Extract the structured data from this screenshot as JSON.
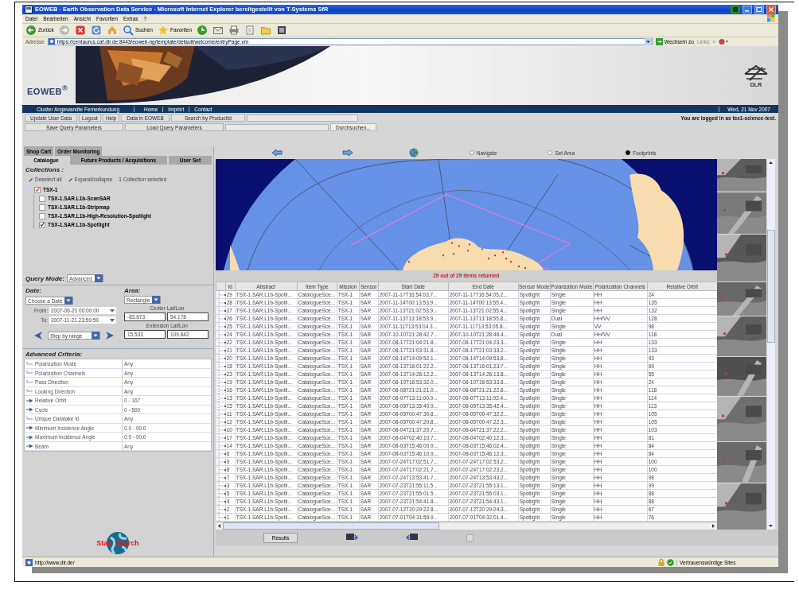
{
  "browser": {
    "title": "EOWEB - Earth Observation Data Service - Microsoft Internet Explorer bereitgestellt von T-Systems SfR",
    "menu": [
      "Datei",
      "Bearbeiten",
      "Ansicht",
      "Favoriten",
      "Extras",
      "?"
    ],
    "toolbar": [
      {
        "kind": "back",
        "label": "Zurück"
      },
      {
        "kind": "forward"
      },
      {
        "kind": "stop"
      },
      {
        "kind": "refresh"
      },
      {
        "kind": "home"
      },
      {
        "kind": "search",
        "label": "Suchen"
      },
      {
        "kind": "favorites",
        "label": "Favoriten"
      },
      {
        "kind": "history"
      },
      {
        "kind": "mail"
      },
      {
        "kind": "print"
      },
      {
        "kind": "edit"
      },
      {
        "kind": "folder"
      },
      {
        "kind": "media"
      }
    ],
    "address": {
      "label": "Adresse",
      "url": "https://centaurus.caf.dlr.de:8443/eoweb-ng/template/default/welcome/entryPage.vm",
      "go": "Wechseln zu",
      "links": "Links",
      "more": "»"
    },
    "status": {
      "url": "http://www.dlr.de/",
      "zone": "Vertrauenswürdige Sites"
    }
  },
  "header": {
    "logo": "EOWEB$^{®}$",
    "emblem": "DLR"
  },
  "nav": {
    "items": [
      "Cluster Angewandte Fernerkundung",
      "Home",
      "Imprint",
      "Contact"
    ],
    "date": "Wed, 21 Nov 2007"
  },
  "actions": {
    "row1": [
      "Update User Data",
      "Logout",
      "Help",
      "Data in EOWEB",
      "Search by ProductId"
    ],
    "login": "You are logged in as tsx1-science-test.",
    "row2": [
      "Save Query Parameters",
      "Load Query Parameters"
    ],
    "browse": "Durchsuchen..."
  },
  "left": {
    "tabs_top": [
      {
        "label": "Shop Cart",
        "selected": false
      },
      {
        "label": "Order Monitoring",
        "selected": false
      }
    ],
    "tabs": [
      {
        "label": "Catalogue",
        "selected": true
      },
      {
        "label": "Future Products / Acquisitions",
        "selected": false
      },
      {
        "label": "User Set",
        "selected": false
      }
    ],
    "collections": {
      "title": "Collections :",
      "tools": [
        "Deselect all",
        "Expand/collapse"
      ],
      "count": "1 Collection selected",
      "tree": [
        {
          "label": "TSX-1",
          "checked": true,
          "children": [
            {
              "label": "TSX-1.SAR.L1b-ScanSAR",
              "checked": false
            },
            {
              "label": "TSX-1.SAR.L1b-Stripmap",
              "checked": false
            },
            {
              "label": "TSX-1.SAR.L1b-High-Resolution-Spotlight",
              "checked": false
            },
            {
              "label": "TSX-1.SAR.L1b-Spotlight",
              "checked": true
            }
          ]
        }
      ]
    },
    "query_mode": {
      "label": "Query Mode:",
      "value": "Advanced"
    },
    "date": {
      "title": "Date:",
      "mode": "Choose a Date",
      "from_label": "From:",
      "from": "2007-06-21 00:00:00",
      "to_label": "To:",
      "to": "2007-11-21 23:59:59",
      "step": "Step by range"
    },
    "area": {
      "title": "Area:",
      "shape": "Rectangle",
      "center_label": "Center Lat/Lon",
      "center": [
        "-83.673",
        "54.178"
      ],
      "extension_label": "Extension Lat/Lon",
      "extension": [
        "15.533",
        "109.842"
      ]
    },
    "criteria": {
      "title": "Advanced Criteria:",
      "rows": [
        {
          "label": "Polarization Mode",
          "value": "Any",
          "expandable": false
        },
        {
          "label": "Polarization Channels",
          "value": "Any",
          "expandable": false
        },
        {
          "label": "Pass Direction",
          "value": "Any",
          "expandable": false
        },
        {
          "label": "Looking Direction",
          "value": "Any",
          "expandable": false
        },
        {
          "label": "Relative Orbit",
          "value": "0 - 167",
          "expandable": true
        },
        {
          "label": "Cycle",
          "value": "0 - 500",
          "expandable": true
        },
        {
          "label": "Unique Datatake Id",
          "value": "Any",
          "expandable": false
        },
        {
          "label": "Minimum Incidence Angle",
          "value": "0.0 - 90.0",
          "expandable": true
        },
        {
          "label": "Maximum Incidence Angle",
          "value": "0.0 - 90.0",
          "expandable": true
        },
        {
          "label": "Beam",
          "value": "Any",
          "expandable": true
        }
      ]
    },
    "search": "Start Search"
  },
  "map": {
    "modes": [
      {
        "label": "Navigate",
        "selected": false
      },
      {
        "label": "Set Area",
        "selected": false
      },
      {
        "label": "Footprints",
        "selected": true
      }
    ]
  },
  "results": {
    "summary": "29 out of 29 items returned",
    "columns": [
      "Id",
      "Abstract",
      "Item Type",
      "Mission",
      "Sensor",
      "Start Date",
      "End Date",
      "Sensor Mode",
      "Polarization Mode",
      "Polarization Channels",
      "Relative Orbit"
    ],
    "rows": [
      [
        "29",
        "TSX-1.SAR.L1b-Spotli...",
        "CatalogueSce...",
        "TSX-1",
        "SAR",
        "2007-11-17T16:54:03.7...",
        "2007-11-17T16:54:05.2...",
        "Spotlight",
        "Single",
        "HH",
        "24"
      ],
      [
        "28",
        "TSX-1.SAR.L1b-Spotli...",
        "CatalogueSce...",
        "TSX-1",
        "SAR",
        "2007-11-14T00:13:53.9...",
        "2007-11-14T00:13:55.4...",
        "Spotlight",
        "Single",
        "HH",
        "135"
      ],
      [
        "27",
        "TSX-1.SAR.L1b-Spotli...",
        "CatalogueSce...",
        "TSX-1",
        "SAR",
        "2007-11-13T21:02:53.9...",
        "2007-11-13T21:02:55.4...",
        "Spotlight",
        "Single",
        "HH",
        "132"
      ],
      [
        "26",
        "TSX-1.SAR.L1b-Spotli...",
        "CatalogueSce...",
        "TSX-1",
        "SAR",
        "2007-11-13T13:18:53.9...",
        "2007-11-13T13:18:55.8...",
        "Spotlight",
        "Dual",
        "HH/VV",
        "128"
      ],
      [
        "25",
        "TSX-1.SAR.L1b-Spotli...",
        "CatalogueSce...",
        "TSX-1",
        "SAR",
        "2007-11-11T13:53:04.3...",
        "2007-11-11T13:53:05.8...",
        "Spotlight",
        "Single",
        "VV",
        "98"
      ],
      [
        "24",
        "TSX-1.SAR.L1b-Spotli...",
        "CatalogueSce...",
        "TSX-1",
        "SAR",
        "2007-10-10T21:28:42.7...",
        "2007-10-10T21:28:46.4...",
        "Spotlight",
        "Dual",
        "HH/VV",
        "118"
      ],
      [
        "22",
        "TSX-1.SAR.L1b-Spotli...",
        "CatalogueSce...",
        "TSX-1",
        "SAR",
        "2007-08-17T21:04:21.8...",
        "2007-08-17T21:04:23.3...",
        "Spotlight",
        "Single",
        "HH",
        "133"
      ],
      [
        "21",
        "TSX-1.SAR.L1b-Spotli...",
        "CatalogueSce...",
        "TSX-1",
        "SAR",
        "2007-08-17T21:03:31.8...",
        "2007-08-17T21:03:33.2...",
        "Spotlight",
        "Single",
        "HH",
        "133"
      ],
      [
        "20",
        "TSX-1.SAR.L1b-Spotli...",
        "CatalogueSce...",
        "TSX-1",
        "SAR",
        "2007-08-14T14:09:52.1...",
        "2007-08-14T14:09:53.8...",
        "Spotlight",
        "Single",
        "HH",
        "93"
      ],
      [
        "18",
        "TSX-1.SAR.L1b-Spotli...",
        "CatalogueSce...",
        "TSX-1",
        "SAR",
        "2007-08-13T16:01:22.2...",
        "2007-08-13T16:01:23.7...",
        "Spotlight",
        "Single",
        "HH",
        "69"
      ],
      [
        "23",
        "TSX-1.SAR.L1b-Spotli...",
        "CatalogueSce...",
        "TSX-1",
        "SAR",
        "2007-08-13T14:26:12.2...",
        "2007-08-13T14:26:13.8...",
        "Spotlight",
        "Single",
        "HH",
        "55"
      ],
      [
        "19",
        "TSX-1.SAR.L1b-Spotli...",
        "CatalogueSce...",
        "TSX-1",
        "SAR",
        "2007-08-10T16:53:32.0...",
        "2007-08-10T16:53:33.8...",
        "Spotlight",
        "Single",
        "HH",
        "24"
      ],
      [
        "16",
        "TSX-1.SAR.L1b-Spotli...",
        "CatalogueSce...",
        "TSX-1",
        "SAR",
        "2007-08-08T21:21:21.0...",
        "2007-08-08T21:21:22.8...",
        "Spotlight",
        "Single",
        "HH",
        "118"
      ],
      [
        "13",
        "TSX-1.SAR.L1b-Spotli...",
        "CatalogueSce...",
        "TSX-1",
        "SAR",
        "2007-08-07T13:11:00.9...",
        "2007-08-07T13:11:02.4...",
        "Spotlight",
        "Single",
        "HH",
        "114"
      ],
      [
        "15",
        "TSX-1.SAR.L1b-Spotli...",
        "CatalogueSce...",
        "TSX-1",
        "SAR",
        "2007-08-05T13:35:40.9...",
        "2007-08-05T13:35:42.4...",
        "Spotlight",
        "Single",
        "HH",
        "113"
      ],
      [
        "11",
        "TSX-1.SAR.L1b-Spotli...",
        "CatalogueSce...",
        "TSX-1",
        "SAR",
        "2007-08-05T00:47:30.8...",
        "2007-08-05T00:47:32.2...",
        "Spotlight",
        "Single",
        "HH",
        "105"
      ],
      [
        "12",
        "TSX-1.SAR.L1b-Spotli...",
        "CatalogueSce...",
        "TSX-1",
        "SAR",
        "2007-08-05T00:47:20.8...",
        "2007-08-05T00:47:22.3...",
        "Spotlight",
        "Single",
        "HH",
        "105"
      ],
      [
        "10",
        "TSX-1.SAR.L1b-Spotli...",
        "CatalogueSce...",
        "TSX-1",
        "SAR",
        "2007-08-04T21:37:20.7...",
        "2007-08-04T21:37:22.2...",
        "Spotlight",
        "Single",
        "HH",
        "103"
      ],
      [
        "17",
        "TSX-1.SAR.L1b-Spotli...",
        "CatalogueSce...",
        "TSX-1",
        "SAR",
        "2007-08-04T02:40:10.7...",
        "2007-08-04T02:40:12.3...",
        "Spotlight",
        "Single",
        "HH",
        "81"
      ],
      [
        "14",
        "TSX-1.SAR.L1b-Spotli...",
        "CatalogueSce...",
        "TSX-1",
        "SAR",
        "2007-08-03T15:46:00.9...",
        "2007-08-03T15:46:02.4...",
        "Spotlight",
        "Single",
        "HH",
        "84"
      ],
      [
        "6",
        "TSX-1.SAR.L1b-Spotli...",
        "CatalogueSce...",
        "TSX-1",
        "SAR",
        "2007-08-03T15:46:10.9...",
        "2007-08-03T15:46:12.3...",
        "Spotlight",
        "Single",
        "HH",
        "84"
      ],
      [
        "9",
        "TSX-1.SAR.L1b-Spotli...",
        "CatalogueSce...",
        "TSX-1",
        "SAR",
        "2007-07-24T17:02:51.7...",
        "2007-07-24T17:02:53.2...",
        "Spotlight",
        "Single",
        "HH",
        "100"
      ],
      [
        "8",
        "TSX-1.SAR.L1b-Spotli...",
        "CatalogueSce...",
        "TSX-1",
        "SAR",
        "2007-07-24T17:02:21.7...",
        "2007-07-24T17:02:23.2...",
        "Spotlight",
        "Single",
        "HH",
        "100"
      ],
      [
        "7",
        "TSX-1.SAR.L1b-Spotli...",
        "CatalogueSce...",
        "TSX-1",
        "SAR",
        "2007-07-24T13:53:41.7...",
        "2007-07-24T13:53:43.2...",
        "Spotlight",
        "Single",
        "HH",
        "98"
      ],
      [
        "3",
        "TSX-1.SAR.L1b-Spotli...",
        "CatalogueSce...",
        "TSX-1",
        "SAR",
        "2007-07-23T21:55:11.5...",
        "2007-07-23T21:55:13.1...",
        "Spotlight",
        "Single",
        "HH",
        "99"
      ],
      [
        "5",
        "TSX-1.SAR.L1b-Spotli...",
        "CatalogueSce...",
        "TSX-1",
        "SAR",
        "2007-07-23T21:55:01.5...",
        "2007-07-23T21:55:03.1...",
        "Spotlight",
        "Single",
        "HH",
        "88"
      ],
      [
        "4",
        "TSX-1.SAR.L1b-Spotli...",
        "CatalogueSce...",
        "TSX-1",
        "SAR",
        "2007-07-23T21:54:41.8...",
        "2007-07-23T21:54:43.1...",
        "Spotlight",
        "Single",
        "HH",
        "88"
      ],
      [
        "2",
        "TSX-1.SAR.L1b-Spotli...",
        "CatalogueSce...",
        "TSX-1",
        "SAR",
        "2007-07-12T20:29:22.8...",
        "2007-07-12T20:29:24.3...",
        "Spotlight",
        "Single",
        "HH",
        "67"
      ],
      [
        "1",
        "TSX-1.SAR.L1b-Spotli...",
        "CatalogueSce...",
        "TSX-1",
        "SAR",
        "2007-07-01T04:31:59.9...",
        "2007-07-01T04:32:01.4...",
        "Spotlight",
        "Single",
        "HH",
        "76"
      ]
    ]
  },
  "bottom": {
    "results": "Results",
    "option_checked": false
  }
}
